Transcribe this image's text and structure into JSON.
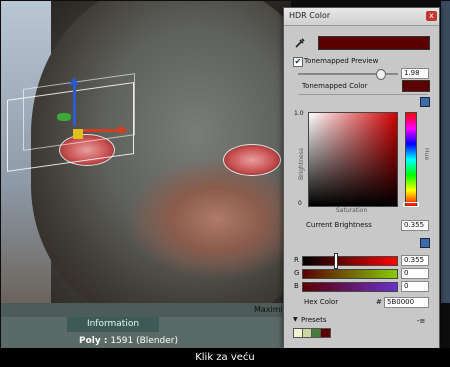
{
  "window": {
    "title": "HDR Color",
    "close_label": "x"
  },
  "color": {
    "hex": "5B0000",
    "hex_label": "Hex Color",
    "hash": "#",
    "swatch": "#5b0000"
  },
  "tonemapped": {
    "preview_label": "Tonemapped Preview",
    "preview_checked": true,
    "check_mark": "✔",
    "exposure_value": "1.98",
    "color_label": "Tonemapped Color"
  },
  "brightness_axis": {
    "top": "1.0",
    "label": "Brightness",
    "bottom": "0"
  },
  "saturation_label": "Saturation",
  "hue_label": "Hue",
  "current_brightness": {
    "label": "Current Brightness",
    "value": "0.355"
  },
  "channels": [
    {
      "name": "R",
      "value": "0.355",
      "level": 0.355
    },
    {
      "name": "G",
      "value": "0",
      "level": 0
    },
    {
      "name": "B",
      "value": "0",
      "level": 0
    }
  ],
  "presets": {
    "label": "Presets",
    "menu": "-≡",
    "colors": [
      "#f4f4d0",
      "#c8d8a0",
      "#4a7a3a",
      "#5b0000"
    ]
  },
  "scene": {
    "info_tab": "Information",
    "poly_label": "Poly :",
    "poly_value": "1591 (Blender)",
    "maximize": "Maximiz"
  },
  "caption": "Klik za veću",
  "icons": {
    "eyedropper": "eyedropper-icon",
    "settings": "settings-icon"
  }
}
